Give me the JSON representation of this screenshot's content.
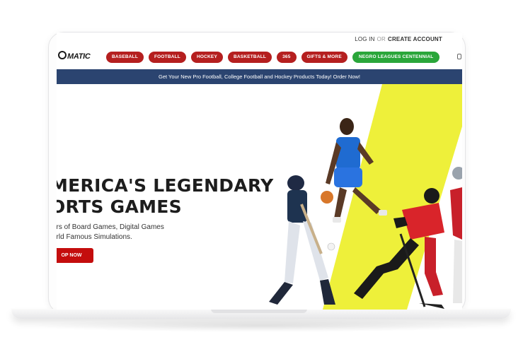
{
  "header": {
    "login_label": "LOG IN",
    "or_label": "OR",
    "create_account_label": "CREATE ACCOUNT",
    "logo_text": "MATIC"
  },
  "nav": {
    "items": [
      {
        "label": "BASEBALL"
      },
      {
        "label": "FOOTBALL"
      },
      {
        "label": "HOCKEY"
      },
      {
        "label": "BASKETBALL"
      },
      {
        "label": "365"
      },
      {
        "label": "GIFTS & MORE"
      },
      {
        "label": "NEGRO LEAGUES CENTENNIAL"
      }
    ]
  },
  "banner": {
    "text": "Get Your New Pro Football, College Football and Hockey Products Today! Order Now!"
  },
  "hero": {
    "headline_line1": "MERICA'S LEGENDARY",
    "headline_line2": "ORTS GAMES",
    "subtext_line1": "ars of Board Games, Digital Games",
    "subtext_line2": "orld Famous Simulations.",
    "cta_label": "OP NOW"
  },
  "colors": {
    "nav_red": "#b51f1f",
    "nav_green": "#2aa63a",
    "banner_blue": "#2b4470",
    "accent_yellow": "#eef03a",
    "cta_red": "#c40d0d"
  }
}
